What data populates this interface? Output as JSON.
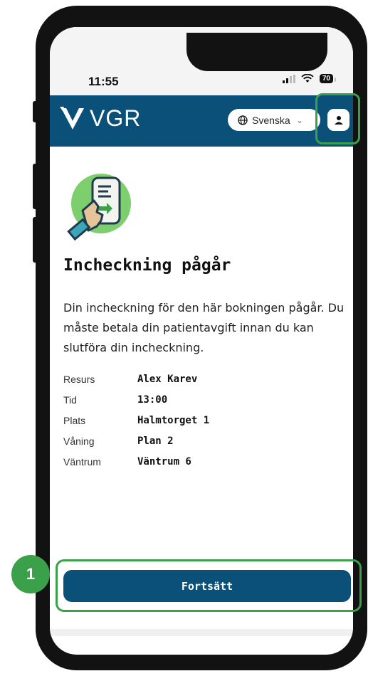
{
  "status_bar": {
    "time": "11:55",
    "battery": "70",
    "signal_icon": "signal-bars-icon",
    "wifi_icon": "wifi-icon"
  },
  "header": {
    "logo_text": "VGR",
    "logo_icon": "vgr-logo-icon",
    "language": "Svenska",
    "language_icon": "globe-icon",
    "profile_icon": "person-icon",
    "background": "#0a5078"
  },
  "main": {
    "illustration_icon": "hand-holding-phone-icon",
    "title": "Incheckning pågår",
    "description": "Din incheckning för den här bokningen pågår. Du måste betala din patientavgift innan du kan slutföra din incheckning.",
    "details": [
      {
        "label": "Resurs",
        "value": "Alex Karev"
      },
      {
        "label": "Tid",
        "value": "13:00"
      },
      {
        "label": "Plats",
        "value": "Halmtorget 1"
      },
      {
        "label": "Våning",
        "value": "Plan 2"
      },
      {
        "label": "Väntrum",
        "value": "Väntrum 6"
      }
    ],
    "continue_label": "Fortsätt"
  },
  "annotations": {
    "step_number": "1",
    "highlight_color": "#3aa04a"
  }
}
